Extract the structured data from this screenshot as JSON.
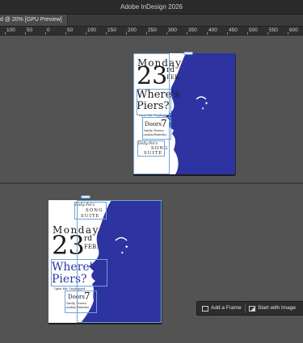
{
  "app": {
    "title": "Adobe InDesign 2026"
  },
  "tab": {
    "label": "d @ 20% [GPU Preview]"
  },
  "ruler": {
    "labels": [
      "100",
      "50",
      "0",
      "50",
      "100",
      "150",
      "200",
      "250",
      "300",
      "350",
      "400",
      "450",
      "500",
      "550",
      "600"
    ]
  },
  "poster": {
    "day": "Monday",
    "date": "23",
    "ord": "rd",
    "month": "FEB.",
    "headline1": "Where's",
    "headline2": "Piers?",
    "tagline": "Open Mic Unplugged",
    "doors_label": "Doors",
    "doors_time": "7",
    "venue1": "Vaulty Towers",
    "venue2": "London/Waterloo",
    "credit1": "Dolly Pet's",
    "credit2": "SONG",
    "credit3": "SUITE",
    "blue": "#2d33a0"
  },
  "context_bar": {
    "add_frame": "Add a Frame",
    "start_image": "Start with Image"
  }
}
